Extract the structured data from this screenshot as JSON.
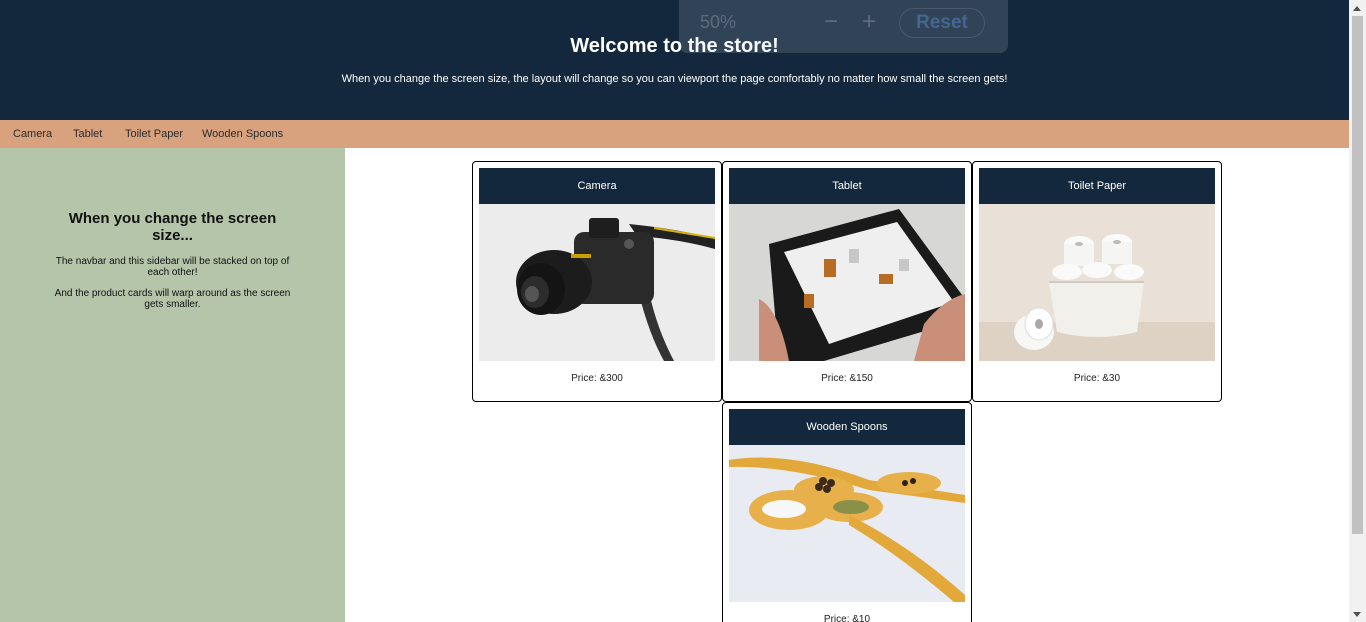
{
  "header": {
    "title": "Welcome to the store!",
    "subtitle": "When you change the screen size, the layout will change so you can viewport the page comfortably no matter how small the screen gets!"
  },
  "zoom": {
    "level": "50%",
    "minus": "−",
    "plus": "+",
    "reset": "Reset"
  },
  "nav": {
    "items": [
      {
        "label": "Camera"
      },
      {
        "label": "Tablet"
      },
      {
        "label": "Toilet Paper"
      },
      {
        "label": "Wooden Spoons"
      }
    ]
  },
  "sidebar": {
    "heading": "When you change the screen size...",
    "para1": "The navbar and this sidebar will be stacked on top of each other!",
    "para2": "And the product cards will warp around as the screen gets smaller."
  },
  "products": [
    {
      "name": "Camera",
      "price": "Price: &300",
      "image": "camera-photo"
    },
    {
      "name": "Tablet",
      "price": "Price: &150",
      "image": "tablet-photo"
    },
    {
      "name": "Toilet Paper",
      "price": "Price: &30",
      "image": "toilet-paper-photo"
    },
    {
      "name": "Wooden Spoons",
      "price": "Price: &10",
      "image": "wooden-spoons-photo"
    }
  ],
  "colors": {
    "header_bg": "#14283d",
    "nav_bg": "#d8a27f",
    "sidebar_bg": "#b5c5aa"
  }
}
